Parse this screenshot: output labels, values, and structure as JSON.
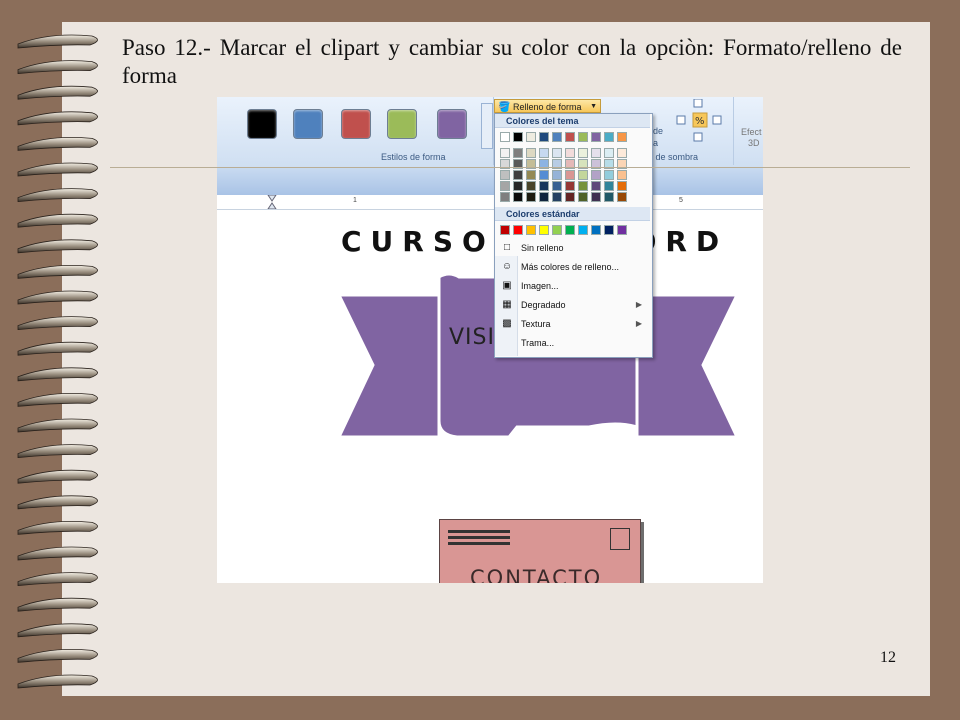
{
  "slide": {
    "title": "Paso 12.- Marcar el clipart y cambiar su color con la opciòn: Formato/relleno de forma",
    "page_number": "12"
  },
  "ribbon": {
    "group_styles_label": "Estilos de forma",
    "group_shadow_label": "tos de sombra",
    "effects_label_1": "Efect",
    "effects_label_2": "3D",
    "frag_de": "de",
    "frag_a": "a",
    "shape_swatches": [
      "#000000",
      "#4f81bd",
      "#c0504d",
      "#9bbb59",
      "#8064a2"
    ],
    "fill_button_label": "Relleno de forma",
    "ruler_marks": [
      "1",
      "5"
    ]
  },
  "fill_menu": {
    "theme_colors_label": "Colores del tema",
    "standard_colors_label": "Colores estándar",
    "theme_top_row": [
      "#ffffff",
      "#000000",
      "#eeece1",
      "#1f497d",
      "#4f81bd",
      "#c0504d",
      "#9bbb59",
      "#8064a2",
      "#4bacc6",
      "#f79646"
    ],
    "theme_shades": [
      [
        "#f2f2f2",
        "#7f7f7f",
        "#ddd9c3",
        "#c6d9f0",
        "#dbe5f1",
        "#f2dcdb",
        "#ebf1dd",
        "#e5e0ec",
        "#dbeef3",
        "#fdeada"
      ],
      [
        "#d8d8d8",
        "#595959",
        "#c4bd97",
        "#8db3e2",
        "#b8cce4",
        "#e5b9b7",
        "#d7e3bc",
        "#ccc1d9",
        "#b7dde8",
        "#fbd5b5"
      ],
      [
        "#bfbfbf",
        "#3f3f3f",
        "#938953",
        "#548dd4",
        "#95b3d7",
        "#d99694",
        "#c3d69b",
        "#b2a2c7",
        "#92cddc",
        "#fac08f"
      ],
      [
        "#a5a5a5",
        "#262626",
        "#494429",
        "#17365d",
        "#366092",
        "#953734",
        "#76923c",
        "#5f497a",
        "#31859b",
        "#e36c09"
      ],
      [
        "#7f7f7f",
        "#0c0c0c",
        "#1d1b10",
        "#0f243e",
        "#244061",
        "#632423",
        "#4f6128",
        "#3f3151",
        "#205867",
        "#974806"
      ]
    ],
    "standard_colors": [
      "#c00000",
      "#ff0000",
      "#ffc000",
      "#ffff00",
      "#92d050",
      "#00b050",
      "#00b0f0",
      "#0070c0",
      "#002060",
      "#7030a0"
    ],
    "items": [
      {
        "label": "Sin relleno",
        "icon": "no-fill-icon",
        "submenu": false
      },
      {
        "label": "Más colores de relleno...",
        "icon": "palette-icon",
        "submenu": false
      },
      {
        "label": "Imagen...",
        "icon": "picture-icon",
        "submenu": false
      },
      {
        "label": "Degradado",
        "icon": "gradient-icon",
        "submenu": true
      },
      {
        "label": "Textura",
        "icon": "texture-icon",
        "submenu": true
      },
      {
        "label": "Trama...",
        "icon": "pattern-icon",
        "submenu": false
      }
    ]
  },
  "document": {
    "heading": "CURSO DE WORD",
    "banner_text": "VISI",
    "banner_color": "#8064a2",
    "postcard_text": "CONTACTO",
    "postcard_color": "#d99694"
  }
}
